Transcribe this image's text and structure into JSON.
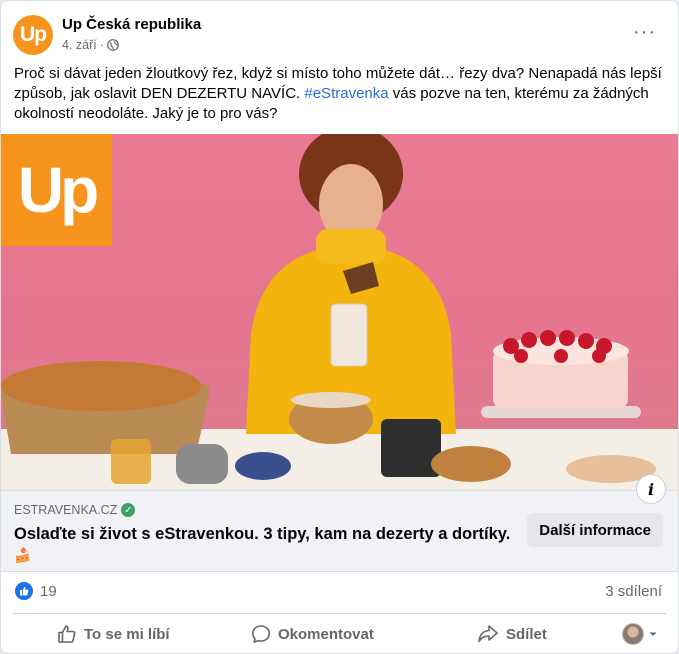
{
  "post": {
    "page_name": "Up Česká republika",
    "avatar_text": "Up",
    "date": "4. září",
    "text_before_hashtag": "Proč si dávat jeden žloutkový řez, když si místo toho můžete dát… řezy dva? Nenapadá nás lepší způsob, jak oslavit DEN DEZERTU NAVÍC. ",
    "hashtag": "#eStravenka",
    "text_after_hashtag": " vás pozve na ten, kterému za žádných okolností neodoláte. Jaký je to pro vás?",
    "more_icon": "···"
  },
  "image": {
    "logo_text": "Up",
    "info_icon": "i"
  },
  "link": {
    "domain": "ESTRAVENKA.CZ",
    "title": "Oslaďte si život s eStravenkou. 3 tipy, kam na dezerty a dortíky.",
    "emoji": "🍰",
    "button_label": "Další informace"
  },
  "stats": {
    "likes": "19",
    "shares": "3 sdílení"
  },
  "actions": {
    "like": "To se mi líbí",
    "comment": "Okomentovat",
    "share": "Sdílet"
  },
  "colors": {
    "brand_orange": "#f7941d",
    "hashtag_blue": "#216fdb",
    "like_blue": "#1b74e4",
    "photo_pink": "#e97a93"
  }
}
